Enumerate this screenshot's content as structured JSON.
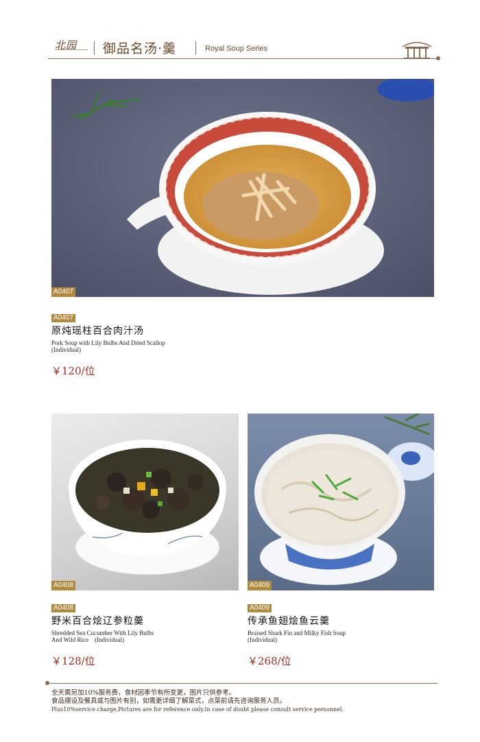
{
  "header": {
    "logo_text": "北园",
    "cn_title": "御品名汤·羹",
    "en_title": "Royal Soup Series"
  },
  "items": [
    {
      "photo_code": "A0407",
      "code": "A0407",
      "name_cn": "原炖瑶柱百合肉汁汤",
      "name_en": "Pork Soup with Lily Bulbs And Dried Scallop\n(Individual)",
      "price": "￥120/位"
    },
    {
      "photo_code": "A0408",
      "code": "A0408",
      "name_cn": "野米百合烩辽参粒羹",
      "name_en": "Shredded Sea Cucumber With Lily Bulbs\nAnd Wild Rice　(Individual)",
      "price": "￥128/位"
    },
    {
      "photo_code": "A0409",
      "code": "A0409",
      "name_cn": "传承鱼翅烩鱼云羹",
      "name_en": "Braised Shark Fin and Milky Fish Soup\n(Individual)",
      "price": "￥268/位"
    }
  ],
  "footer": {
    "line1": "全天需另加10%服务费，食材因季节有所变更，图片只供参考。",
    "line2": "食品摆设及餐具或与图片有别，如需更详细了解菜式，点菜前请先咨询服务人员。",
    "line3": "Plus10%service charge,Pictures are for reference only.In case of doubt please consult service personnel."
  },
  "colors": {
    "accent_brown": "#8a6d50",
    "code_tag": "#b28a3e",
    "price_red": "#a52a1c"
  }
}
